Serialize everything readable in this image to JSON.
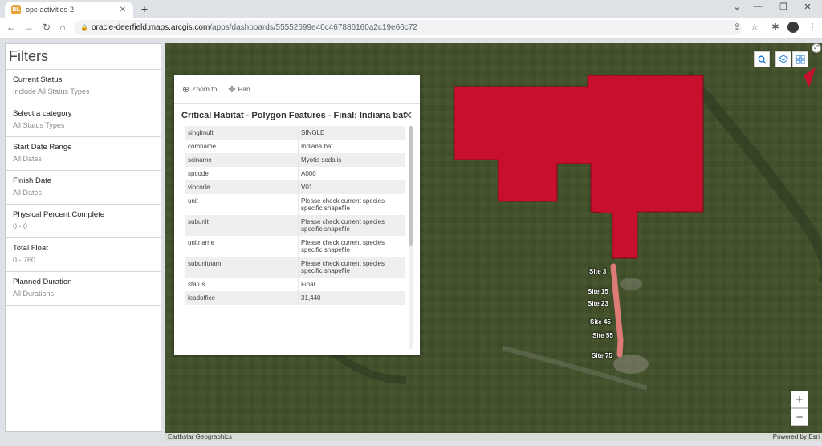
{
  "browser": {
    "tab_title": "opc-activities-2",
    "favicon_text": "BL",
    "url_host": "oracle-deerfield.maps.arcgis.com",
    "url_path": "/apps/dashboards/55552699e40c467886160a2c19e66c72"
  },
  "filters": {
    "title": "Filters",
    "items": [
      {
        "label": "Current Status",
        "value": "Include All Status Types"
      },
      {
        "label": "Select a category",
        "value": "All Status Types"
      },
      {
        "label": "Start Date Range",
        "value": "All Dates"
      },
      {
        "label": "Finish Date",
        "value": "All Dates"
      },
      {
        "label": "Physical Percent Complete",
        "value": "0 - 0"
      },
      {
        "label": "Total Float",
        "value": "0 - 760"
      },
      {
        "label": "Planned Duration",
        "value": "All Durations"
      }
    ]
  },
  "popup": {
    "zoom_label": "Zoom to",
    "pan_label": "Pan",
    "title": "Critical Habitat - Polygon Features - Final: Indiana bat",
    "rows": [
      {
        "key": "singlmulti",
        "value": "SINGLE"
      },
      {
        "key": "comname",
        "value": "Indiana bat"
      },
      {
        "key": "sciname",
        "value": "Myotis sodalis"
      },
      {
        "key": "spcode",
        "value": "A000"
      },
      {
        "key": "vipcode",
        "value": "V01"
      },
      {
        "key": "unit",
        "value": "Please check current species specific shapefile"
      },
      {
        "key": "subunit",
        "value": "Please check current species specific shapefile"
      },
      {
        "key": "unitname",
        "value": "Please check current species specific shapefile"
      },
      {
        "key": "subunitnam",
        "value": "Please check current species specific shapefile"
      },
      {
        "key": "status",
        "value": "Final"
      },
      {
        "key": "leadoffice",
        "value": "31,440"
      }
    ]
  },
  "map": {
    "sites": [
      "Site 3",
      "Site 15",
      "Site 23",
      "Site 45",
      "Site 55",
      "Site 75"
    ],
    "attribution_left": "Earthstar Geographics",
    "attribution_right": "Powered by Esri",
    "zoom_in": "+",
    "zoom_out": "−",
    "habitat_color": "#c8102e",
    "site_color": "#f08080"
  }
}
